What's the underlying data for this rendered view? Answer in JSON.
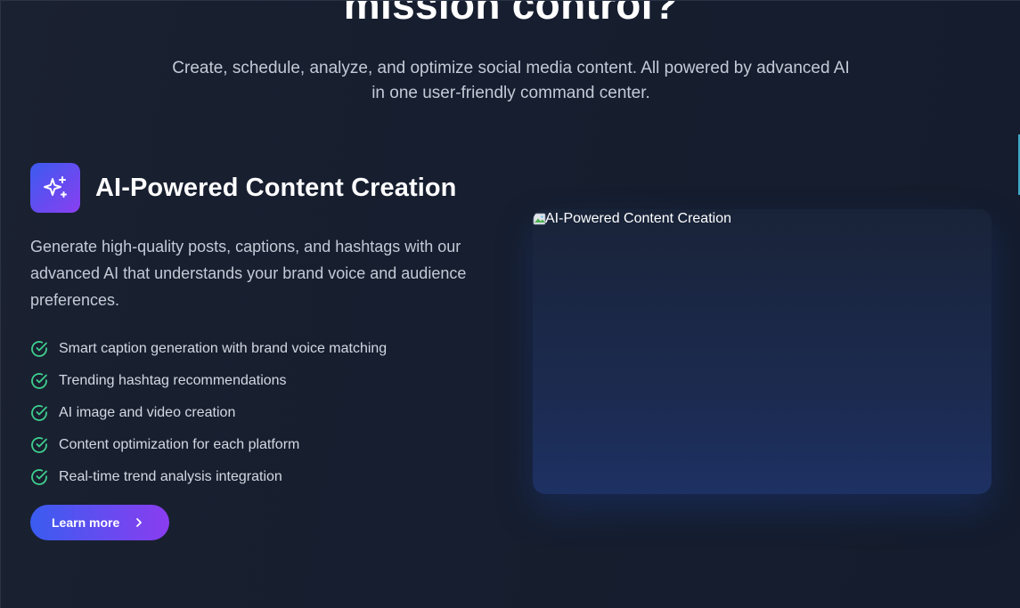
{
  "hero": {
    "title": "mission control?",
    "subtitle": "Create, schedule, analyze, and optimize social media content. All powered by advanced AI in one user-friendly command center."
  },
  "feature": {
    "icon": "sparkles-icon",
    "title": "AI-Powered Content Creation",
    "description": "Generate high-quality posts, captions, and hashtags with our advanced AI that understands your brand voice and audience preferences.",
    "benefits": [
      "Smart caption generation with brand voice matching",
      "Trending hashtag recommendations",
      "AI image and video creation",
      "Content optimization for each platform",
      "Real-time trend analysis integration"
    ],
    "cta_label": "Learn more",
    "image_alt": "AI-Powered Content Creation"
  },
  "colors": {
    "background": "#161e2f",
    "accent_start": "#3a5cf0",
    "accent_end": "#8a3df0",
    "check": "#3fcf8e"
  }
}
